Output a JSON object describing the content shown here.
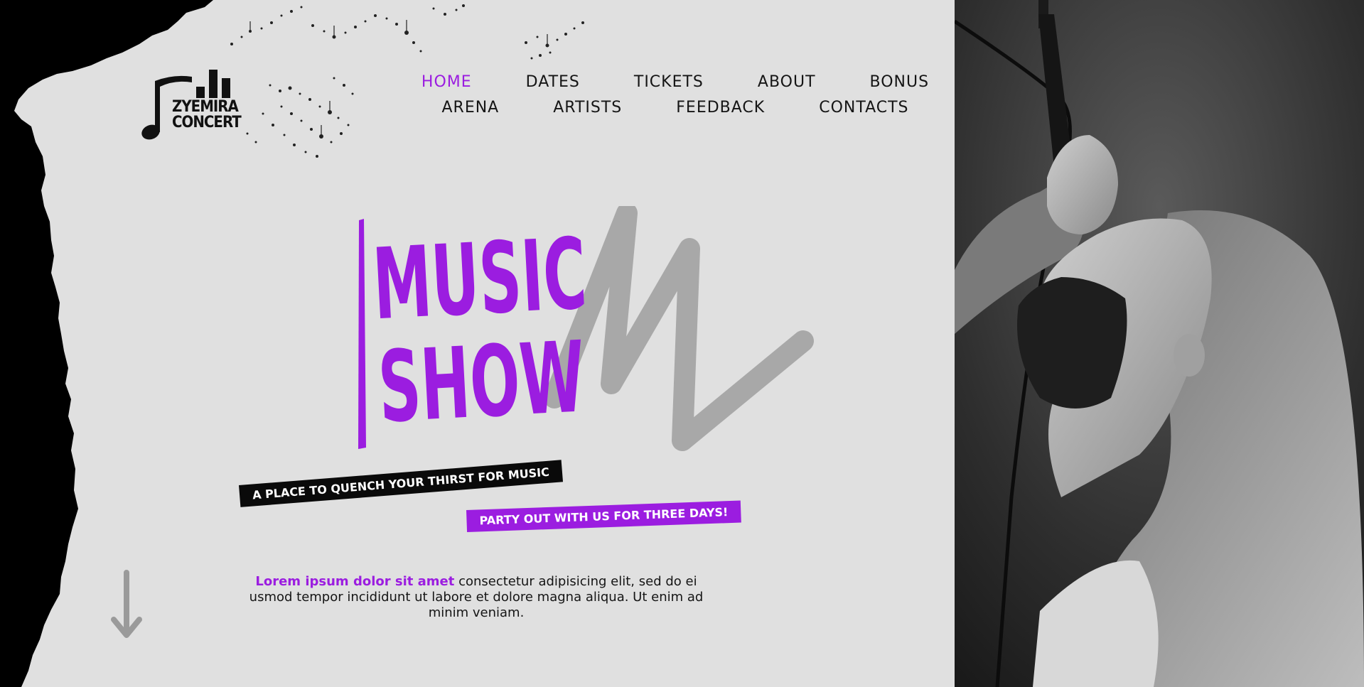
{
  "brand": {
    "logo_line1": "ZYEMIRA",
    "logo_line2": "CONCERT"
  },
  "nav": {
    "row1": [
      {
        "label": "HOME",
        "active": true
      },
      {
        "label": "DATES",
        "active": false
      },
      {
        "label": "TICKETS",
        "active": false
      },
      {
        "label": "ABOUT",
        "active": false
      },
      {
        "label": "BONUS",
        "active": false
      }
    ],
    "row2": [
      {
        "label": "ARENA",
        "active": false
      },
      {
        "label": "ARTISTS",
        "active": false
      },
      {
        "label": "FEEDBACK",
        "active": false
      },
      {
        "label": "CONTACTS",
        "active": false
      }
    ]
  },
  "hero": {
    "title_line1": "MUSIC",
    "title_line2": "SHOW",
    "tagline_primary": "A PLACE TO QUENCH YOUR THIRST FOR MUSIC",
    "tagline_secondary": "PARTY OUT WITH US FOR THREE DAYS!",
    "lead_highlight": "Lorem ipsum dolor sit amet",
    "lead_text": " consectetur adipisicing elit, sed do ei usmod tempor incididunt ut labore et dolore magna aliqua. Ut enim ad minim veniam."
  },
  "colors": {
    "accent": "#9b1de0",
    "background": "#e0e0e0",
    "dark": "#0a0a0a",
    "scribble": "#a8a8a8"
  },
  "icons": {
    "logo": "music-note-equalizer-icon",
    "scroll": "arrow-down-icon"
  }
}
